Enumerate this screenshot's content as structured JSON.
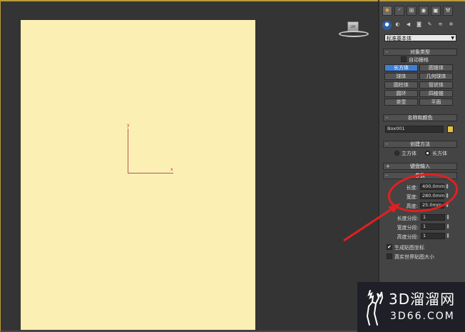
{
  "viewport": {
    "axis_x_label": "x",
    "axis_y_label": "y",
    "viewcube_label": "LW",
    "background_color": "#343434",
    "paper_color": "#fcefb4",
    "axis_color": "#b05a50"
  },
  "command_panel": {
    "main_tabs": [
      "create-icon",
      "modify-icon",
      "hierarchy-icon",
      "motion-icon",
      "display-icon",
      "utilities-icon"
    ],
    "sub_tabs": [
      "geometry-icon",
      "shapes-icon",
      "lights-icon",
      "cameras-icon",
      "helpers-icon",
      "space-warps-icon",
      "systems-icon"
    ],
    "category_dropdown": "标准基本体",
    "object_type": {
      "title": "对象类型",
      "autogrid_label": "自动栅格",
      "buttons": [
        "长方体",
        "圆锥体",
        "球体",
        "几何球体",
        "圆柱体",
        "管状体",
        "圆环",
        "四棱锥",
        "茶壶",
        "平面"
      ],
      "active_button": "长方体"
    },
    "name_color": {
      "title": "名称和颜色",
      "name_value": "Box001",
      "swatch_color": "#e8c040"
    },
    "creation_method": {
      "title": "创建方法",
      "options": [
        "立方体",
        "长方体"
      ],
      "selected": "长方体"
    },
    "keyboard_entry": {
      "title": "键盘输入"
    },
    "parameters": {
      "title": "参数",
      "length_label": "长度:",
      "length_value": "400.0mm",
      "width_label": "宽度:",
      "width_value": "280.0mm",
      "height_label": "高度:",
      "height_value": "25.0mm",
      "length_segs_label": "长度分段:",
      "length_segs_value": "1",
      "width_segs_label": "宽度分段:",
      "width_segs_value": "1",
      "height_segs_label": "高度分段:",
      "height_segs_value": "1",
      "gen_map_coords_label": "生成贴图坐标",
      "gen_map_coords_checked": true,
      "real_world_label": "真实世界贴图大小",
      "real_world_checked": false
    }
  },
  "annotation_color": "#e02020",
  "watermark": {
    "line1": "3D溜溜网",
    "line2": "3D66.COM"
  }
}
